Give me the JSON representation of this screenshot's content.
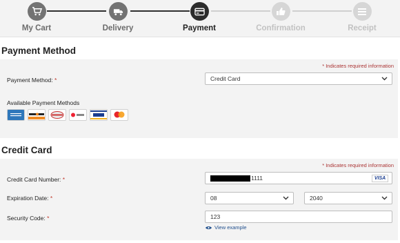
{
  "stepper": {
    "steps": [
      {
        "label": "My Cart",
        "icon": "cart-icon",
        "state": "done"
      },
      {
        "label": "Delivery",
        "icon": "truck-icon",
        "state": "done"
      },
      {
        "label": "Payment",
        "icon": "credit-card-icon",
        "state": "active"
      },
      {
        "label": "Confirmation",
        "icon": "thumbs-up-icon",
        "state": "todo"
      },
      {
        "label": "Receipt",
        "icon": "list-icon",
        "state": "todo"
      }
    ]
  },
  "payment_method": {
    "title": "Payment Method",
    "required_note": "* Indicates required information",
    "method_label": "Payment Method:",
    "method_value": "Credit Card",
    "available_label": "Available Payment Methods",
    "available_cards": [
      "American Express",
      "Discover",
      "Diners Club",
      "BCcard",
      "Visa",
      "Mastercard"
    ]
  },
  "credit_card": {
    "title": "Credit Card",
    "required_note": "* Indicates required information",
    "number_label": "Credit Card Number:",
    "number_value": "1111",
    "number_brand": "VISA",
    "expiration_label": "Expiration Date:",
    "exp_month": "08",
    "exp_year": "2040",
    "security_label": "Security Code:",
    "security_value": "123",
    "view_example": "View example"
  },
  "colors": {
    "required_star": "#c0392b",
    "panel_bg": "#f3f3f3",
    "link": "#1f4e8c",
    "active_step": "#2c2c2c"
  }
}
